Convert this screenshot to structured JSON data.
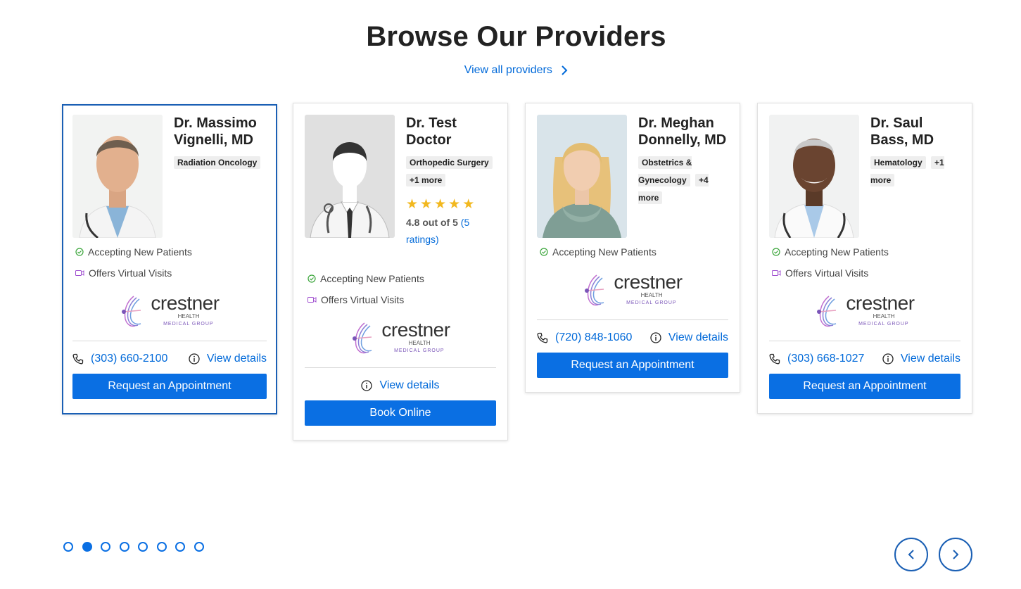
{
  "header": {
    "title": "Browse Our Providers",
    "view_all_label": "View all providers"
  },
  "providers": [
    {
      "name": "Dr. Massimo Vignelli, MD",
      "specialties": [
        "Radiation Oncology"
      ],
      "features": [
        "Accepting New Patients",
        "Offers Virtual Visits"
      ],
      "phone": "(303) 660-2100",
      "details_label": "View details",
      "cta_label": "Request an Appointment"
    },
    {
      "name": "Dr. Test Doctor",
      "specialties": [
        "Orthopedic Surgery",
        "+1 more"
      ],
      "rating": {
        "stars": 5,
        "text": "4.8 out of 5",
        "count_label": "(5 ratings)"
      },
      "features": [
        "Accepting New Patients",
        "Offers Virtual Visits"
      ],
      "details_label": "View details",
      "cta_label": "Book Online"
    },
    {
      "name": "Dr. Meghan Donnelly, MD",
      "specialties": [
        "Obstetrics & Gynecology",
        "+4 more"
      ],
      "features": [
        "Accepting New Patients"
      ],
      "phone": "(720) 848-1060",
      "details_label": "View details",
      "cta_label": "Request an Appointment"
    },
    {
      "name": "Dr. Saul Bass, MD",
      "specialties": [
        "Hematology",
        "+1 more"
      ],
      "features": [
        "Accepting New Patients",
        "Offers Virtual Visits"
      ],
      "phone": "(303) 668-1027",
      "details_label": "View details",
      "cta_label": "Request an Appointment"
    }
  ],
  "logo": {
    "main": "crestner",
    "sub1": "HEALTH",
    "sub2": "MEDICAL GROUP"
  },
  "pagination": {
    "total_pages": 8,
    "active_page": 2
  },
  "colors": {
    "accent": "#0a6fe3",
    "border_selected": "#1a5fb4",
    "check": "#3aa53a",
    "video": "#a050d0",
    "star": "#f2b81f"
  },
  "icons": {
    "view_all": "chevron-right-icon",
    "accepting": "check-circle-icon",
    "virtual": "video-camera-icon",
    "phone": "phone-icon",
    "details": "info-circle-icon",
    "prev": "chevron-left-icon",
    "next": "chevron-right-icon"
  }
}
